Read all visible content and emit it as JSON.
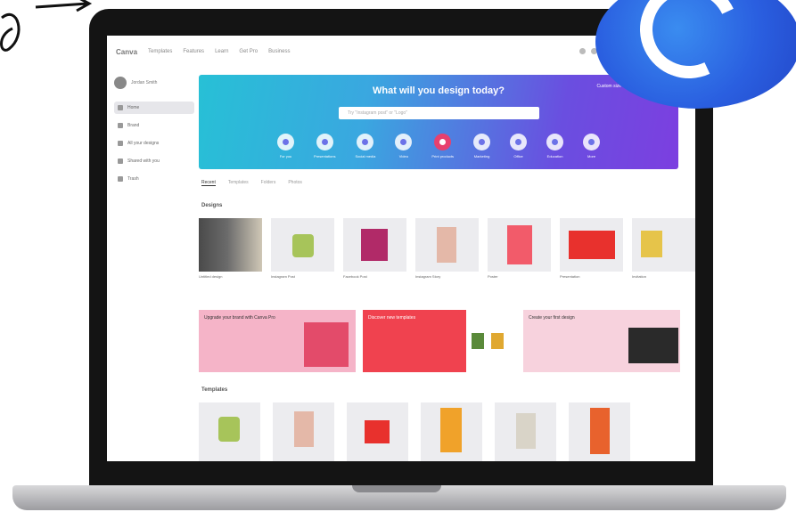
{
  "nav": {
    "logo": "Canva",
    "items": [
      "Templates",
      "Features",
      "Learn",
      "Get Pro",
      "Business"
    ]
  },
  "sidebar": {
    "profile_name": "Jordan Smith",
    "items": [
      {
        "label": "Home",
        "active": true
      },
      {
        "label": "Brand"
      },
      {
        "label": "All your designs"
      },
      {
        "label": "Shared with you"
      },
      {
        "label": "Trash"
      }
    ]
  },
  "hero": {
    "title": "What will you design today?",
    "search_placeholder": "Try \"Instagram post\" or \"Logo\"",
    "right_link": "Custom size",
    "categories": [
      {
        "label": "For you"
      },
      {
        "label": "Presentations"
      },
      {
        "label": "Social media"
      },
      {
        "label": "Video"
      },
      {
        "label": "Print products",
        "active": true
      },
      {
        "label": "Marketing"
      },
      {
        "label": "Office"
      },
      {
        "label": "Education"
      },
      {
        "label": "More"
      }
    ]
  },
  "tabs": [
    "Recent",
    "Templates",
    "Folders",
    "Photos"
  ],
  "sections": {
    "designs": "Designs",
    "templates": "Templates"
  },
  "designs": [
    {
      "caption": "Untitled design"
    },
    {
      "caption": "Instagram Post"
    },
    {
      "caption": "Facebook Post"
    },
    {
      "caption": "Instagram Story"
    },
    {
      "caption": "Poster"
    },
    {
      "caption": "Presentation"
    },
    {
      "caption": "Invitation"
    }
  ],
  "banners": [
    {
      "text": "Upgrade your brand with Canva Pro",
      "color": "#f5b4c8"
    },
    {
      "text": "Discover new templates",
      "color": "#f0424f"
    },
    {
      "text": "Create your first design",
      "color": "#f7d2dd"
    }
  ],
  "colors": {
    "hero_start": "#27c0d6",
    "hero_end": "#7c3fe0",
    "badge": "#2a5fe0"
  }
}
